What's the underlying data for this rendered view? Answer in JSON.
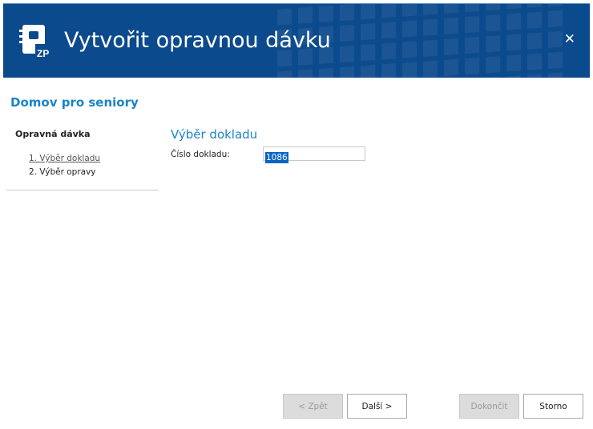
{
  "window": {
    "title": "Vytvořit opravnou dávku",
    "close_label": "✕",
    "logo_text": "ZP",
    "accent_color": "#0b4a8c"
  },
  "organization": "Domov pro seniory",
  "sidebar": {
    "heading": "Opravná dávka",
    "steps": [
      {
        "label": "1. Výběr dokladu"
      },
      {
        "label": "2. Výběr opravy"
      }
    ]
  },
  "main": {
    "section_title": "Výběr dokladu",
    "field_label": "Číslo dokladu:",
    "field_value": "1086"
  },
  "buttons": {
    "back": "< Zpět",
    "next": "Další >",
    "finish": "Dokončit",
    "cancel": "Storno"
  }
}
